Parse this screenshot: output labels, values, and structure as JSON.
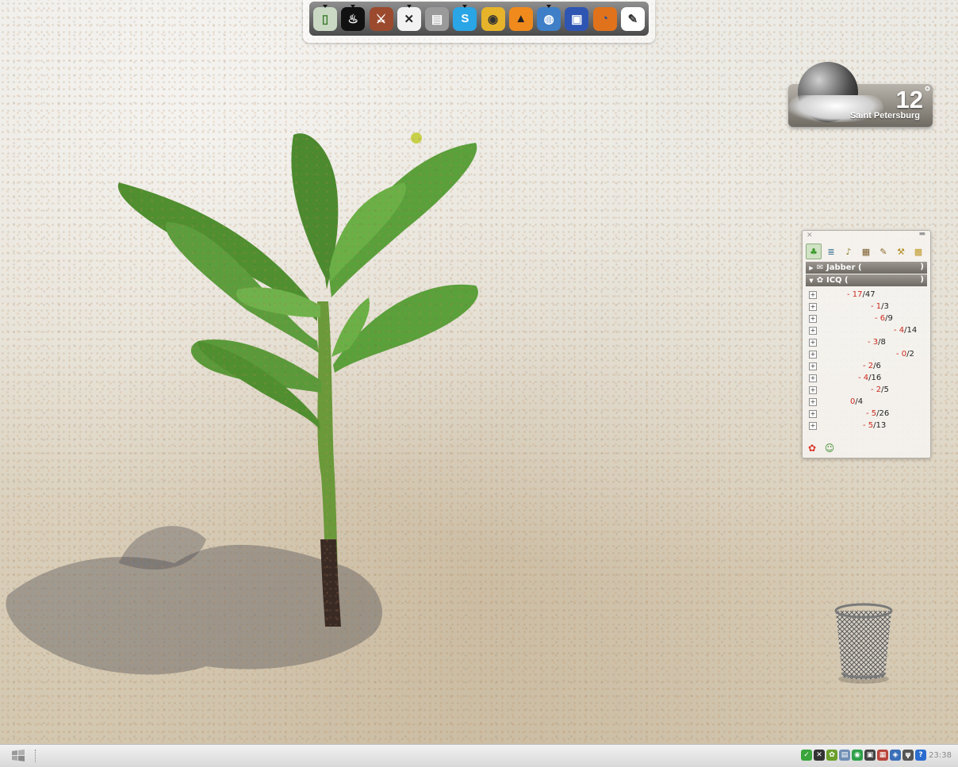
{
  "dock": {
    "items": [
      {
        "name": "gadget-icon",
        "glyph": "▯",
        "bg": "#c9d9c4",
        "fg": "#3c7d2d",
        "running": true
      },
      {
        "name": "steam-icon",
        "glyph": "♨",
        "bg": "#111111",
        "fg": "#ffffff",
        "running": true
      },
      {
        "name": "battlefield-icon",
        "glyph": "⚔",
        "bg": "#9b4a2e",
        "fg": "#ffffff",
        "running": false
      },
      {
        "name": "xfire-icon",
        "glyph": "✕",
        "bg": "#f2f2f2",
        "fg": "#222222",
        "running": true
      },
      {
        "name": "book-icon",
        "glyph": "▤",
        "bg": "#9a9a9a",
        "fg": "#ffffff",
        "running": false
      },
      {
        "name": "skype-icon",
        "glyph": "S",
        "bg": "#2aa5e6",
        "fg": "#ffffff",
        "running": true
      },
      {
        "name": "qip-icon",
        "glyph": "◉",
        "bg": "#e6b32a",
        "fg": "#333333",
        "running": false
      },
      {
        "name": "aimp-icon",
        "glyph": "▲",
        "bg": "#f08a1c",
        "fg": "#222222",
        "running": false
      },
      {
        "name": "network-globe-icon",
        "glyph": "◍",
        "bg": "#3f7fc7",
        "fg": "#ffffff",
        "running": true
      },
      {
        "name": "floppy-save-icon",
        "glyph": "▣",
        "bg": "#2f55b3",
        "fg": "#ffffff",
        "running": false
      },
      {
        "name": "firefox-icon",
        "glyph": "◔",
        "bg": "#e0721c",
        "fg": "#1f4e9a",
        "running": false
      },
      {
        "name": "notepad-icon",
        "glyph": "✎",
        "bg": "#ffffff",
        "fg": "#333333",
        "running": false
      }
    ]
  },
  "weather": {
    "temperature": "12",
    "degree": "°",
    "city": "Saint Petersburg"
  },
  "messenger": {
    "toolbar": [
      {
        "name": "contacts-icon",
        "glyph": "♣",
        "color": "#3b9a2b",
        "active": true
      },
      {
        "name": "list-view-icon",
        "glyph": "≣",
        "color": "#2b6b8c",
        "active": false
      },
      {
        "name": "sound-icon",
        "glyph": "♪",
        "color": "#8a7a2a",
        "active": false
      },
      {
        "name": "history-icon",
        "glyph": "▦",
        "color": "#7a5b2a",
        "active": false
      },
      {
        "name": "edit-icon",
        "glyph": "✎",
        "color": "#8a6a2a",
        "active": false
      },
      {
        "name": "tools-icon",
        "glyph": "⚒",
        "color": "#b08a1a",
        "active": false
      },
      {
        "name": "folder-icon",
        "glyph": "▩",
        "color": "#c09a2a",
        "active": false
      }
    ],
    "accounts": [
      {
        "name": "jabber-account",
        "arrow": "▶",
        "icon": "✉",
        "label": "Jabber (",
        "close": ")"
      },
      {
        "name": "icq-account",
        "arrow": "▼",
        "icon": "✿",
        "label": "ICQ (",
        "close": ")"
      }
    ],
    "groups": [
      {
        "dash": "-",
        "online": "17",
        "total": "/47",
        "offset": 56
      },
      {
        "dash": "-",
        "online": "1",
        "total": "/3",
        "offset": 86
      },
      {
        "dash": "-",
        "online": "6",
        "total": "/9",
        "offset": 91
      },
      {
        "dash": "-",
        "online": "4",
        "total": "/14",
        "offset": 115
      },
      {
        "dash": "-",
        "online": "3",
        "total": "/8",
        "offset": 82
      },
      {
        "dash": "-",
        "online": "0",
        "total": "/2",
        "offset": 118
      },
      {
        "dash": "-",
        "online": "2",
        "total": "/6",
        "offset": 76
      },
      {
        "dash": "-",
        "online": "4",
        "total": "/16",
        "offset": 70
      },
      {
        "dash": "-",
        "online": "2",
        "total": "/5",
        "offset": 86
      },
      {
        "dash": "",
        "online": "0",
        "total": "/4",
        "offset": 60
      },
      {
        "dash": "-",
        "online": "5",
        "total": "/26",
        "offset": 80
      },
      {
        "dash": "-",
        "online": "5",
        "total": "/13",
        "offset": 76
      }
    ],
    "expander_symbol": "+",
    "statusbar": [
      {
        "name": "status-online-icon",
        "glyph": "✿",
        "color": "#d9352a"
      },
      {
        "name": "xstatus-icon",
        "glyph": "☺",
        "color": "#3a8a2a"
      }
    ]
  },
  "taskbar": {
    "tray": [
      {
        "name": "tray-qip-icon",
        "glyph": "✓",
        "bg": "#39a53a"
      },
      {
        "name": "tray-xfire-icon",
        "glyph": "✕",
        "bg": "#333333"
      },
      {
        "name": "tray-icq-icon",
        "glyph": "✿",
        "bg": "#6aa02a"
      },
      {
        "name": "tray-network-icon",
        "glyph": "▤",
        "bg": "#6f8fb5"
      },
      {
        "name": "tray-app-green-icon",
        "glyph": "◉",
        "bg": "#2fa14a"
      },
      {
        "name": "tray-display-icon",
        "glyph": "▣",
        "bg": "#444444"
      },
      {
        "name": "tray-language-flag-icon",
        "glyph": "▦",
        "bg": "#b8443a"
      },
      {
        "name": "tray-connection-icon",
        "glyph": "◈",
        "bg": "#3b6fb8"
      },
      {
        "name": "tray-usb-icon",
        "glyph": "ψ",
        "bg": "#555555"
      },
      {
        "name": "tray-help-icon",
        "glyph": "?",
        "bg": "#2a6ccf"
      }
    ],
    "clock": "23:38"
  }
}
